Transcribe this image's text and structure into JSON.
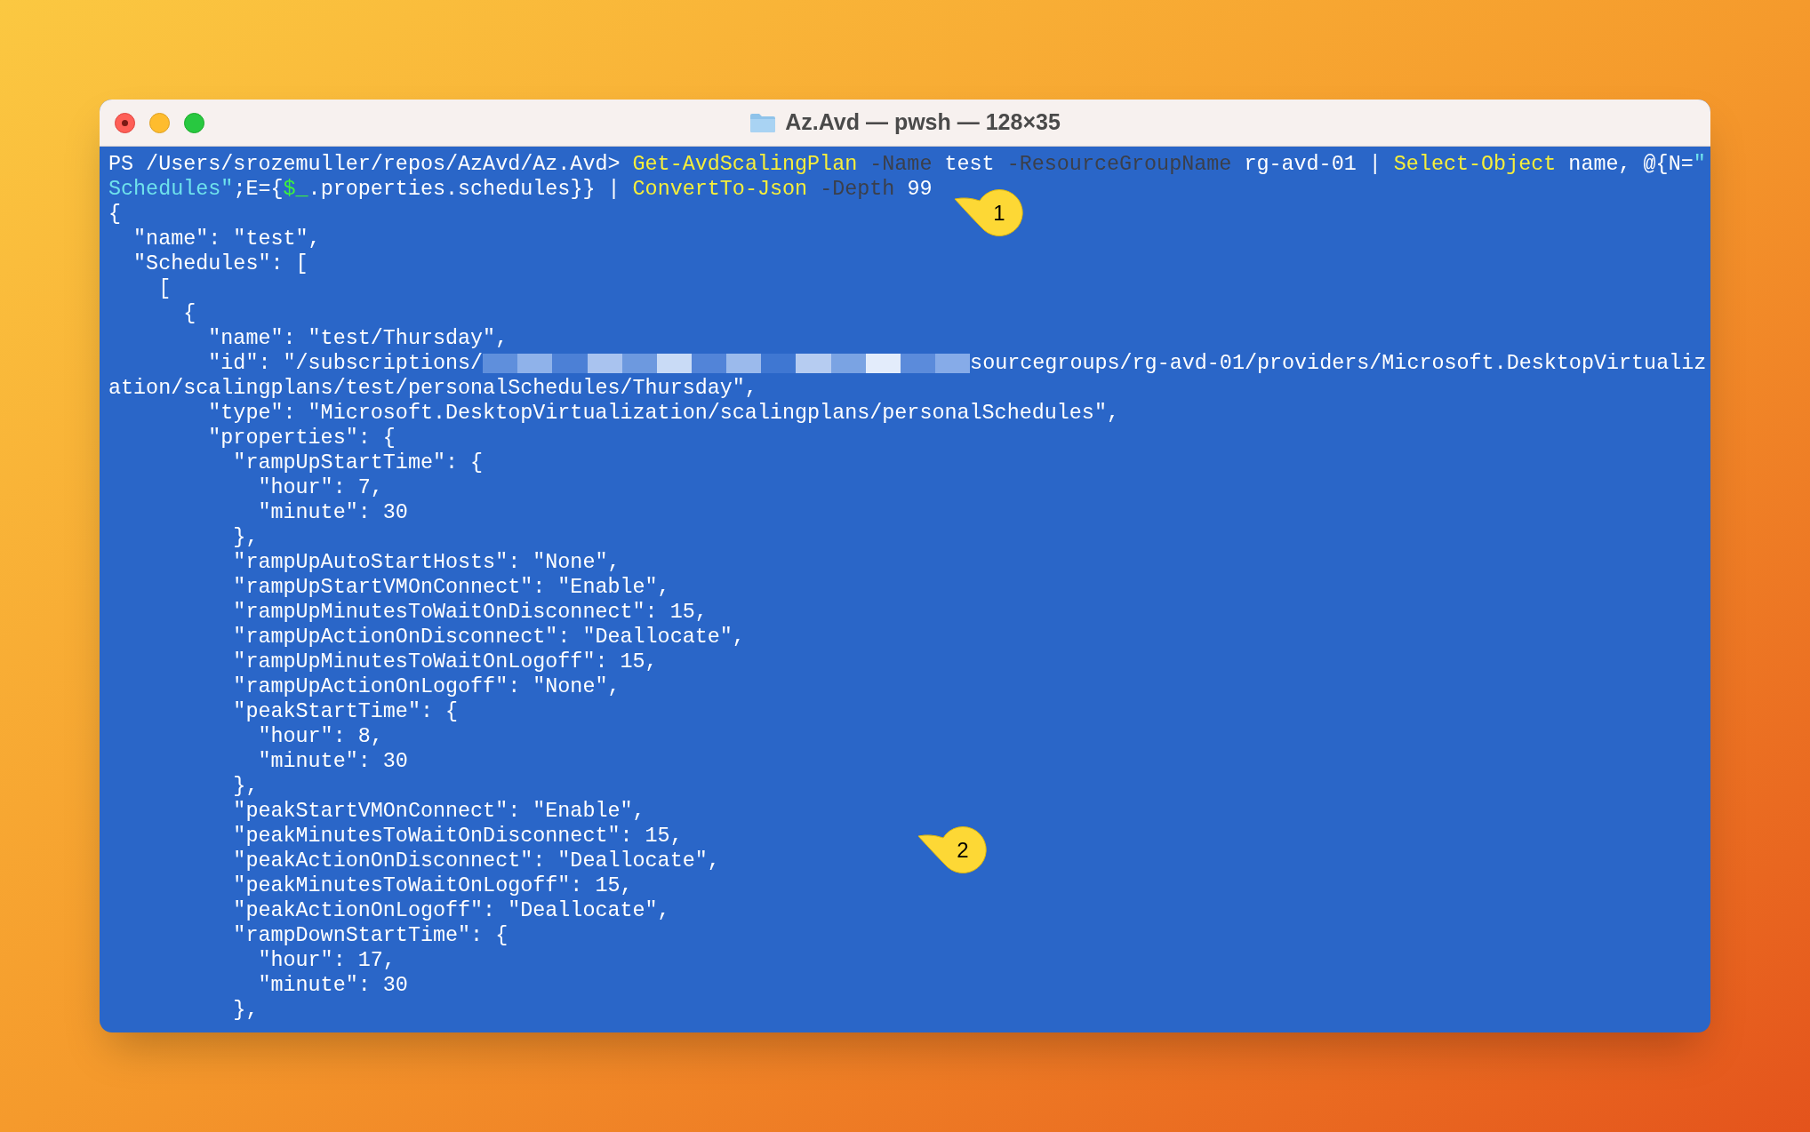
{
  "window": {
    "title": "Az.Avd — pwsh — 128×35"
  },
  "terminal": {
    "lines": [
      {
        "segments": [
          {
            "kind": "prompt",
            "text": "PS /Users/srozemuller/repos/AzAvd/Az.Avd> "
          },
          {
            "kind": "command",
            "text": "Get-AvdScalingPlan"
          },
          {
            "kind": "param",
            "text": " -Name"
          },
          {
            "kind": "plain",
            "text": " test"
          },
          {
            "kind": "param",
            "text": " -ResourceGroupName"
          },
          {
            "kind": "plain",
            "text": " rg-avd-01 | "
          },
          {
            "kind": "command",
            "text": "Select-Object"
          },
          {
            "kind": "plain",
            "text": " name, @{N="
          },
          {
            "kind": "string",
            "text": "\""
          }
        ]
      },
      {
        "segments": [
          {
            "kind": "string",
            "text": "Schedules\""
          },
          {
            "kind": "plain",
            "text": ";E={"
          },
          {
            "kind": "variable",
            "text": "$_"
          },
          {
            "kind": "plain",
            "text": ".properties.schedules}} | "
          },
          {
            "kind": "command",
            "text": "ConvertTo-Json"
          },
          {
            "kind": "param",
            "text": " -Depth"
          },
          {
            "kind": "plain",
            "text": " 99"
          }
        ]
      },
      {
        "segments": [
          {
            "kind": "plain",
            "text": "{"
          }
        ]
      },
      {
        "segments": [
          {
            "kind": "plain",
            "text": "  \"name\": \"test\","
          }
        ]
      },
      {
        "segments": [
          {
            "kind": "plain",
            "text": "  \"Schedules\": ["
          }
        ]
      },
      {
        "segments": [
          {
            "kind": "plain",
            "text": "    ["
          }
        ]
      },
      {
        "segments": [
          {
            "kind": "plain",
            "text": "      {"
          }
        ]
      },
      {
        "segments": [
          {
            "kind": "plain",
            "text": "        \"name\": \"test/Thursday\","
          }
        ]
      },
      {
        "segments": [
          {
            "kind": "plain",
            "text": "        \"id\": \"/subscriptions/"
          },
          {
            "kind": "redacted"
          },
          {
            "kind": "plain",
            "text": "sourcegroups/rg-avd-01/providers/Microsoft.DesktopVirtualiz"
          }
        ]
      },
      {
        "segments": [
          {
            "kind": "plain",
            "text": "ation/scalingplans/test/personalSchedules/Thursday\","
          }
        ]
      },
      {
        "segments": [
          {
            "kind": "plain",
            "text": "        \"type\": \"Microsoft.DesktopVirtualization/scalingplans/personalSchedules\","
          }
        ]
      },
      {
        "segments": [
          {
            "kind": "plain",
            "text": "        \"properties\": {"
          }
        ]
      },
      {
        "segments": [
          {
            "kind": "plain",
            "text": "          \"rampUpStartTime\": {"
          }
        ]
      },
      {
        "segments": [
          {
            "kind": "plain",
            "text": "            \"hour\": 7,"
          }
        ]
      },
      {
        "segments": [
          {
            "kind": "plain",
            "text": "            \"minute\": 30"
          }
        ]
      },
      {
        "segments": [
          {
            "kind": "plain",
            "text": "          },"
          }
        ]
      },
      {
        "segments": [
          {
            "kind": "plain",
            "text": "          \"rampUpAutoStartHosts\": \"None\","
          }
        ]
      },
      {
        "segments": [
          {
            "kind": "plain",
            "text": "          \"rampUpStartVMOnConnect\": \"Enable\","
          }
        ]
      },
      {
        "segments": [
          {
            "kind": "plain",
            "text": "          \"rampUpMinutesToWaitOnDisconnect\": 15,"
          }
        ]
      },
      {
        "segments": [
          {
            "kind": "plain",
            "text": "          \"rampUpActionOnDisconnect\": \"Deallocate\","
          }
        ]
      },
      {
        "segments": [
          {
            "kind": "plain",
            "text": "          \"rampUpMinutesToWaitOnLogoff\": 15,"
          }
        ]
      },
      {
        "segments": [
          {
            "kind": "plain",
            "text": "          \"rampUpActionOnLogoff\": \"None\","
          }
        ]
      },
      {
        "segments": [
          {
            "kind": "plain",
            "text": "          \"peakStartTime\": {"
          }
        ]
      },
      {
        "segments": [
          {
            "kind": "plain",
            "text": "            \"hour\": 8,"
          }
        ]
      },
      {
        "segments": [
          {
            "kind": "plain",
            "text": "            \"minute\": 30"
          }
        ]
      },
      {
        "segments": [
          {
            "kind": "plain",
            "text": "          },"
          }
        ]
      },
      {
        "segments": [
          {
            "kind": "plain",
            "text": "          \"peakStartVMOnConnect\": \"Enable\","
          }
        ]
      },
      {
        "segments": [
          {
            "kind": "plain",
            "text": "          \"peakMinutesToWaitOnDisconnect\": 15,"
          }
        ]
      },
      {
        "segments": [
          {
            "kind": "plain",
            "text": "          \"peakActionOnDisconnect\": \"Deallocate\","
          }
        ]
      },
      {
        "segments": [
          {
            "kind": "plain",
            "text": "          \"peakMinutesToWaitOnLogoff\": 15,"
          }
        ]
      },
      {
        "segments": [
          {
            "kind": "plain",
            "text": "          \"peakActionOnLogoff\": \"Deallocate\","
          }
        ]
      },
      {
        "segments": [
          {
            "kind": "plain",
            "text": "          \"rampDownStartTime\": {"
          }
        ]
      },
      {
        "segments": [
          {
            "kind": "plain",
            "text": "            \"hour\": 17,"
          }
        ]
      },
      {
        "segments": [
          {
            "kind": "plain",
            "text": "            \"minute\": 30"
          }
        ]
      },
      {
        "segments": [
          {
            "kind": "plain",
            "text": "          },"
          }
        ]
      }
    ]
  },
  "callouts": [
    {
      "label": "1"
    },
    {
      "label": "2"
    }
  ]
}
